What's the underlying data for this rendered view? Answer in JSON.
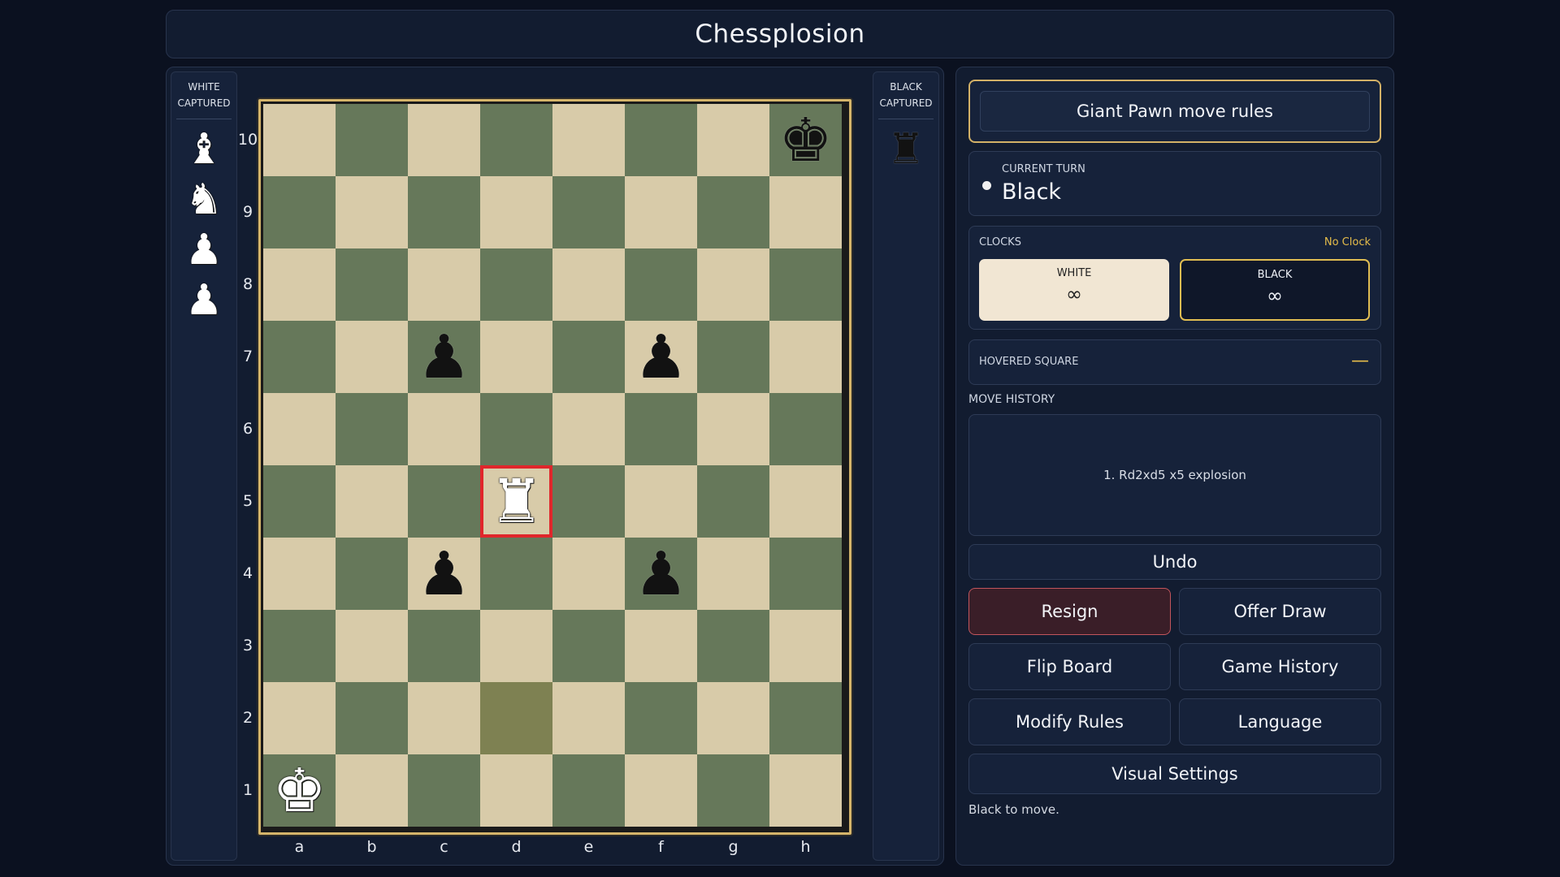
{
  "app": {
    "title": "Chessplosion"
  },
  "captured": {
    "white_title": "WHITE CAPTURED",
    "black_title": "BLACK CAPTURED",
    "white_pieces": [
      {
        "glyph": "♝",
        "color": "white",
        "name": "bishop"
      },
      {
        "glyph": "♞",
        "color": "white",
        "name": "knight"
      },
      {
        "glyph": "♟",
        "color": "white",
        "name": "pawn"
      },
      {
        "glyph": "♟",
        "color": "white",
        "name": "pawn"
      }
    ],
    "black_pieces": [
      {
        "glyph": "♜",
        "color": "black",
        "name": "rook"
      }
    ]
  },
  "board": {
    "files": [
      "a",
      "b",
      "c",
      "d",
      "e",
      "f",
      "g",
      "h"
    ],
    "ranks": [
      "10",
      "9",
      "8",
      "7",
      "6",
      "5",
      "4",
      "3",
      "2",
      "1"
    ],
    "pieces": [
      {
        "square": "h10",
        "glyph": "♚",
        "color": "black",
        "name": "king"
      },
      {
        "square": "c7",
        "glyph": "♟",
        "color": "black",
        "name": "pawn"
      },
      {
        "square": "f7",
        "glyph": "♟",
        "color": "black",
        "name": "pawn"
      },
      {
        "square": "d5",
        "glyph": "♜",
        "color": "white",
        "name": "rook"
      },
      {
        "square": "c4",
        "glyph": "♟",
        "color": "black",
        "name": "pawn"
      },
      {
        "square": "f4",
        "glyph": "♟",
        "color": "black",
        "name": "pawn"
      },
      {
        "square": "a1",
        "glyph": "♚",
        "color": "white",
        "name": "king"
      }
    ],
    "selected_square": "d5",
    "last_move_square": "d2",
    "colors": {
      "light": "#d8cba9",
      "dark": "#66785a",
      "last_move": "#7e8152",
      "selected": "#e0262b",
      "frame": "#d4b46a"
    }
  },
  "side": {
    "rules_button": "Giant Pawn move rules",
    "turn": {
      "caption": "CURRENT TURN",
      "value": "Black"
    },
    "clocks": {
      "caption": "CLOCKS",
      "mode": "No Clock",
      "white": {
        "label": "WHITE",
        "value": "∞"
      },
      "black": {
        "label": "BLACK",
        "value": "∞"
      }
    },
    "hovered": {
      "caption": "HOVERED SQUARE",
      "value": "—"
    },
    "history": {
      "caption": "MOVE HISTORY",
      "entries": [
        "1. Rd2xd5 x5 explosion"
      ]
    },
    "buttons": {
      "undo": "Undo",
      "resign": "Resign",
      "offer_draw": "Offer Draw",
      "flip_board": "Flip Board",
      "game_history": "Game History",
      "modify_rules": "Modify Rules",
      "language": "Language",
      "visual_settings": "Visual Settings"
    },
    "status": "Black to move."
  }
}
